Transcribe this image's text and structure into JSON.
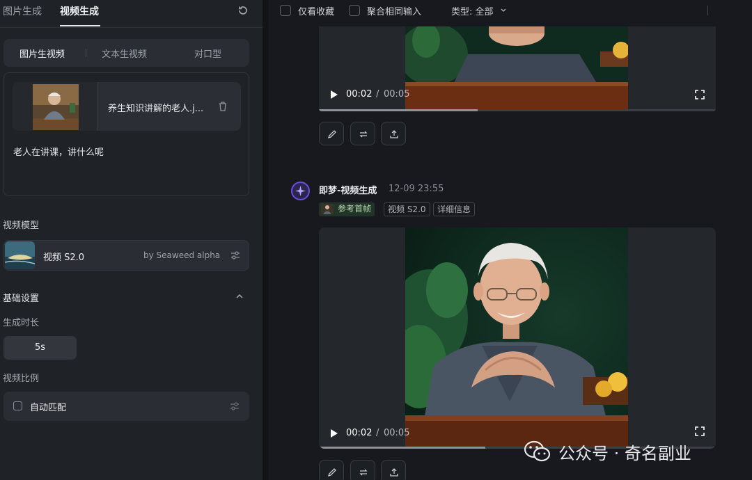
{
  "left_panel": {
    "top_tabs": [
      "图片生成",
      "视频生成"
    ],
    "active_top_tab": "视频生成",
    "modes": [
      "图片生视频",
      "文本生视频",
      "对口型"
    ],
    "active_mode": "图片生视频",
    "file_name": "养生知识讲解的老人.j...",
    "prompt": "老人在讲课，讲什么呢",
    "model_section_label": "视频模型",
    "model_name": "视频 S2.0",
    "model_by": "by Seaweed alpha",
    "basic_settings_label": "基础设置",
    "duration_label": "生成时长",
    "duration_value": "5s",
    "ratio_label": "视频比例",
    "ratio_option": "自动匹配"
  },
  "filter_bar": {
    "favorites_only": "仅看收藏",
    "group_same_input": "聚合相同输入",
    "type_filter": "类型: 全部"
  },
  "videos": [
    {
      "current_time": "00:02",
      "separator": "/",
      "total_time": "00:05",
      "progress": 0.4
    },
    {
      "current_time": "00:02",
      "separator": "/",
      "total_time": "00:05",
      "progress": 0.42
    }
  ],
  "message": {
    "title": "即梦-视频生成",
    "time": "12-09  23:55",
    "tags": [
      "参考首帧",
      "视频 S2.0",
      "详细信息"
    ]
  },
  "watermark": "公众号 · 奇名副业",
  "icons": {
    "refresh": "refresh-icon",
    "trash": "trash-icon",
    "settings": "sliders-icon",
    "collapse": "chevron-up-icon",
    "play": "play-icon",
    "fullscreen": "fullscreen-icon",
    "edit": "pencil-icon",
    "regenerate": "repeat-icon",
    "share": "upload-icon"
  },
  "colors": {
    "background": "#17191e",
    "panel": "#1f2227",
    "accent": "#6b4de6"
  }
}
